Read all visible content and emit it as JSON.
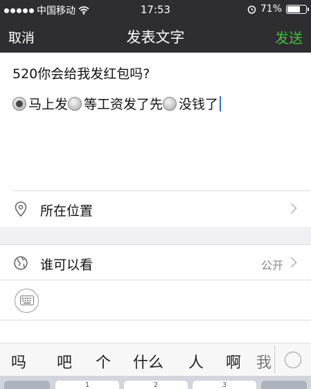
{
  "status_bar": {
    "carrier": "中国移动",
    "time": "17:53",
    "battery_percent": "71%",
    "battery_level": 0.71,
    "icons": [
      "signal-dots-icon",
      "wifi-icon",
      "alarm-icon",
      "battery-icon"
    ]
  },
  "nav": {
    "cancel_label": "取消",
    "title": "发表文字",
    "send_label": "发送",
    "send_color": "#3fc13b"
  },
  "compose": {
    "line1": "520你会给我发红包吗?",
    "options": [
      {
        "label": "马上发",
        "checked": true
      },
      {
        "label": "等工资发了先",
        "checked": false
      },
      {
        "label": "没钱了",
        "checked": false
      }
    ]
  },
  "location_row": {
    "label": "所在位置",
    "icon": "location-pin-icon"
  },
  "visibility_row": {
    "label": "谁可以看",
    "value": "公开",
    "icon": "globe-icon"
  },
  "keyboard_toggle": {
    "icon": "keyboard-icon"
  },
  "candidates": [
    "吗",
    "吧",
    "个",
    "什么",
    "人",
    "啊",
    "我"
  ],
  "keys": [
    "1",
    "2",
    "3"
  ]
}
